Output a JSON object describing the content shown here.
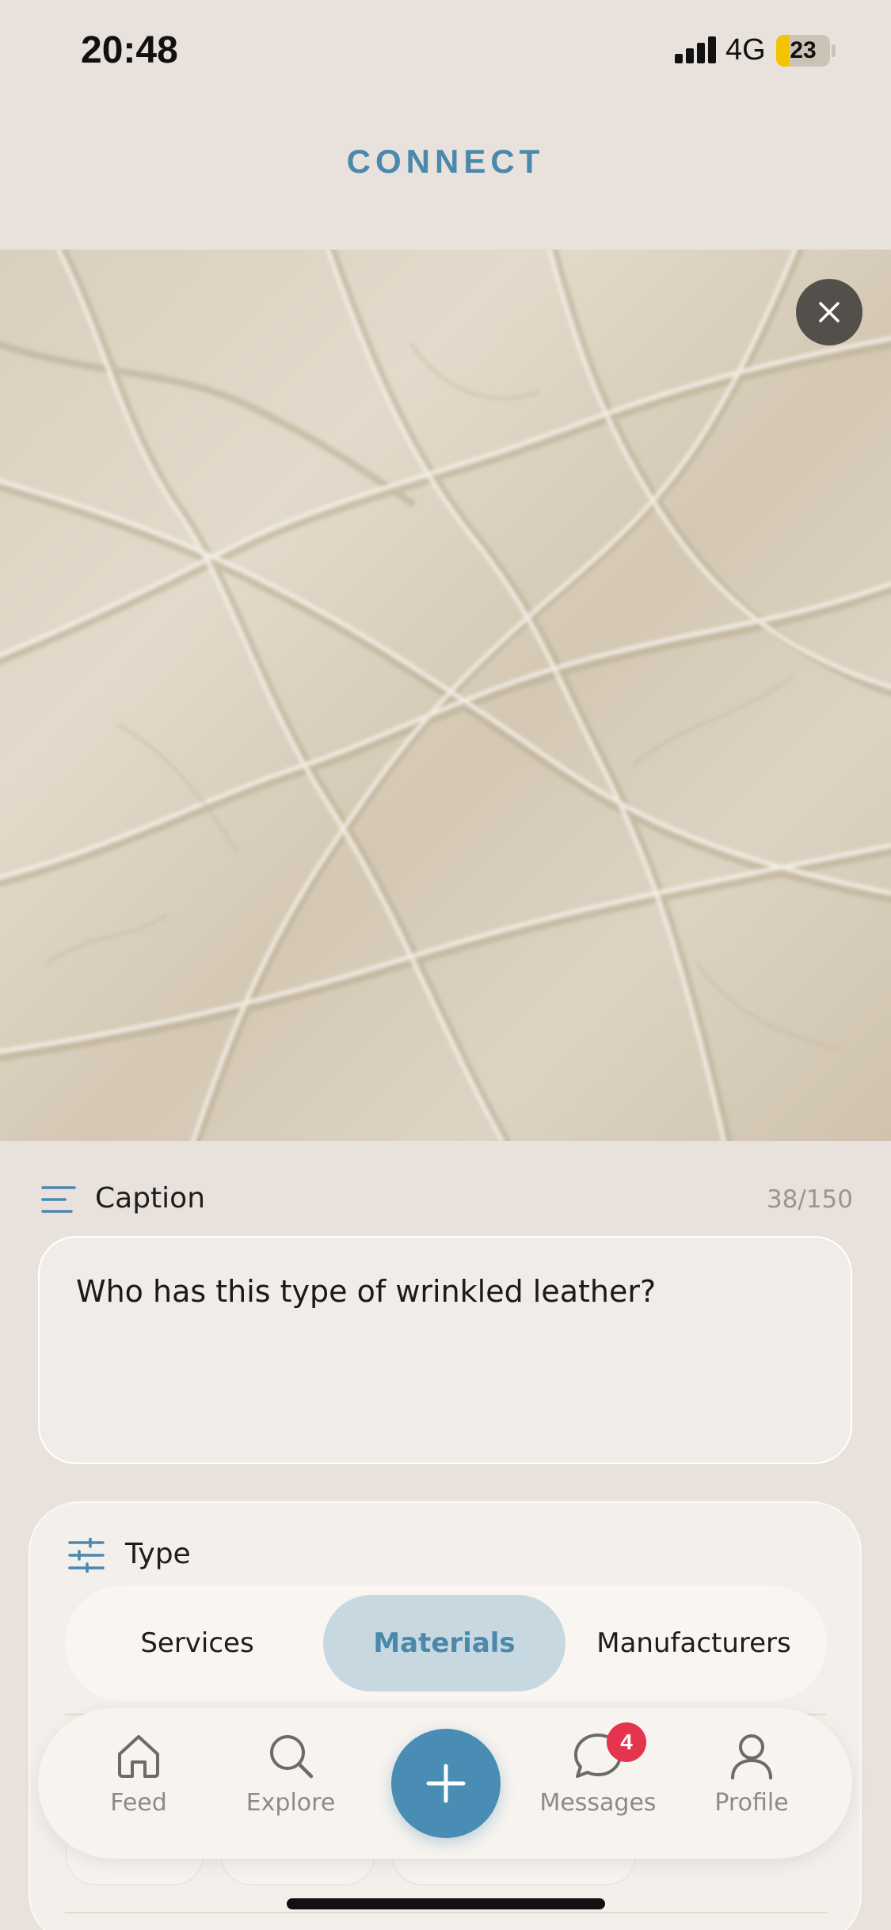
{
  "status_bar": {
    "time": "20:48",
    "network": "4G",
    "battery": "23",
    "battery_level_percent": 23,
    "battery_color": "#f5c400"
  },
  "header": {
    "title": "CONNECT"
  },
  "photo": {
    "close_icon": "close-icon",
    "overlay_color": "#3c3a37"
  },
  "caption": {
    "label": "Caption",
    "counter": "38/150",
    "text": "Who has this type of wrinkled leather?"
  },
  "type": {
    "label": "Type",
    "options": [
      "Services",
      "Materials",
      "Manufacturers"
    ],
    "selected": "Materials"
  },
  "bottom_nav": {
    "items": [
      {
        "label": "Feed",
        "icon": "home-icon"
      },
      {
        "label": "Explore",
        "icon": "search-icon"
      },
      {
        "label": "Messages",
        "icon": "chat-icon",
        "badge": "4"
      },
      {
        "label": "Profile",
        "icon": "user-icon"
      }
    ],
    "add_icon": "plus-icon"
  },
  "colors": {
    "accent": "#4a88ac",
    "background": "#e9e2dc",
    "badge": "#e4344e"
  }
}
